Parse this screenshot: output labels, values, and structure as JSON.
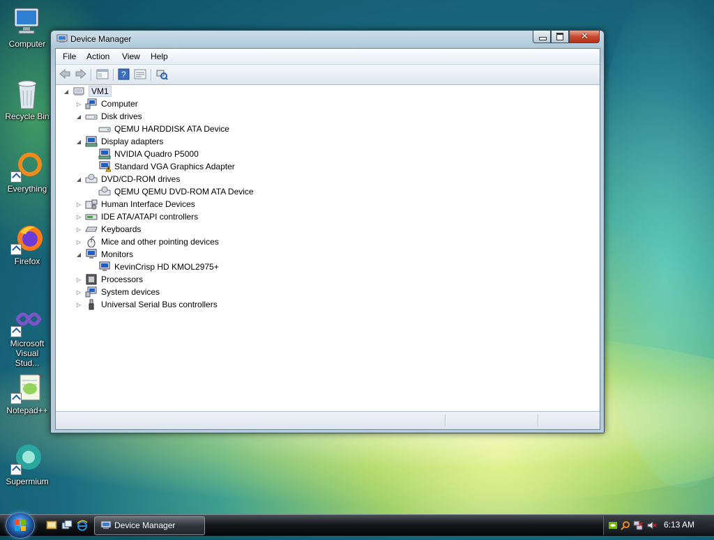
{
  "desktop": {
    "icons": [
      {
        "label": "Computer"
      },
      {
        "label": "Recycle Bin"
      },
      {
        "label": "Everything"
      },
      {
        "label": "Firefox"
      },
      {
        "label": "Microsoft Visual Stud..."
      },
      {
        "label": "Notepad++"
      },
      {
        "label": "Supermium"
      }
    ]
  },
  "window": {
    "title": "Device Manager",
    "menu": [
      "File",
      "Action",
      "View",
      "Help"
    ],
    "tree": {
      "root": "VM1",
      "items": [
        {
          "label": "Computer",
          "expanded": false
        },
        {
          "label": "Disk drives",
          "expanded": true,
          "children": [
            "QEMU HARDDISK ATA Device"
          ]
        },
        {
          "label": "Display adapters",
          "expanded": true,
          "children": [
            "NVIDIA Quadro P5000",
            "Standard VGA Graphics Adapter"
          ]
        },
        {
          "label": "DVD/CD-ROM drives",
          "expanded": true,
          "children": [
            "QEMU QEMU DVD-ROM ATA Device"
          ]
        },
        {
          "label": "Human Interface Devices",
          "expanded": false
        },
        {
          "label": "IDE ATA/ATAPI controllers",
          "expanded": false
        },
        {
          "label": "Keyboards",
          "expanded": false
        },
        {
          "label": "Mice and other pointing devices",
          "expanded": false
        },
        {
          "label": "Monitors",
          "expanded": true,
          "children": [
            "KevinCrisp HD KMOL2975+"
          ]
        },
        {
          "label": "Processors",
          "expanded": false
        },
        {
          "label": "System devices",
          "expanded": false
        },
        {
          "label": "Universal Serial Bus controllers",
          "expanded": false
        }
      ]
    }
  },
  "taskbar": {
    "task_label": "Device Manager",
    "clock": "6:13 AM"
  },
  "colors": {
    "accent": "#2a6fc0",
    "warning": "#f0c419"
  }
}
